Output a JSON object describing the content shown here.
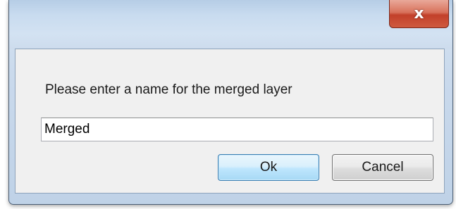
{
  "dialog": {
    "prompt": "Please enter a name for the merged layer",
    "input_value": "Merged",
    "ok_label": "Ok",
    "cancel_label": "Cancel",
    "close_glyph": "x",
    "close_icon": "close-icon"
  },
  "colors": {
    "close_button": "#c2402a",
    "ok_button_border": "#3c7fb1",
    "client_background": "#f0f0f0"
  }
}
